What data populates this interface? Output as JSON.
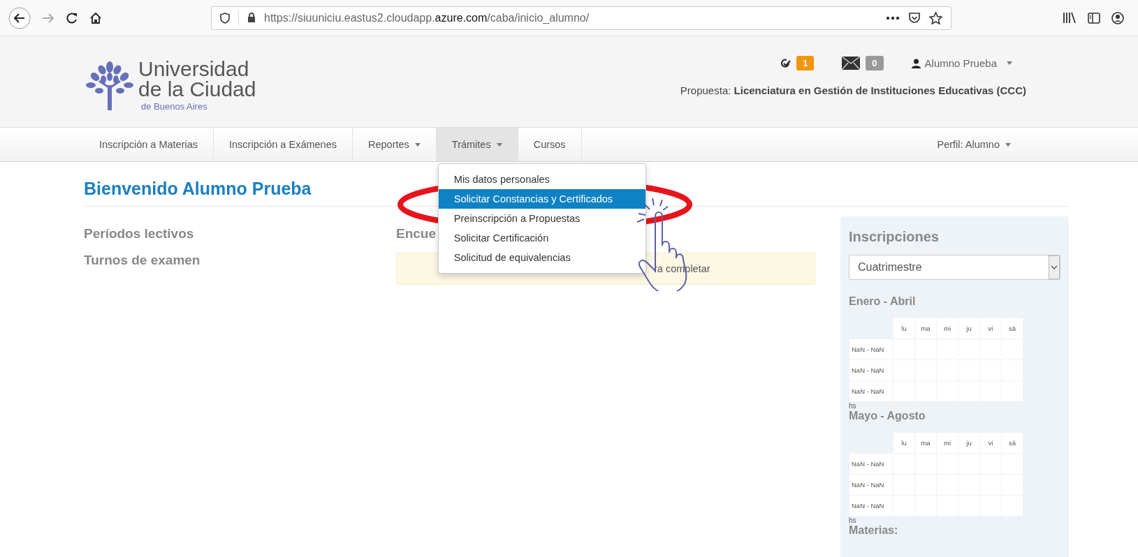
{
  "browser": {
    "url": {
      "prefix": "https://siuuniciu.eastus2.cloudapp.",
      "domain": "azure.com",
      "path": "/caba/inicio_alumno/"
    }
  },
  "header": {
    "logo": {
      "line1": "Universidad",
      "line2": "de la Ciudad",
      "line3": "de Buenos Aires"
    },
    "badges": [
      {
        "kind": "tasks",
        "count": "1",
        "color": "#f0960e"
      },
      {
        "kind": "mail",
        "count": "0",
        "color": "#999999"
      }
    ],
    "user": "Alumno Prueba",
    "propuesta_label": "Propuesta:",
    "propuesta_value": "Licenciatura en Gestión de Instituciones Educativas (CCC)"
  },
  "nav": {
    "items": [
      {
        "label": "Inscripción a Materias",
        "dropdown": false,
        "selected": false
      },
      {
        "label": "Inscripción a Exámenes",
        "dropdown": false,
        "selected": false
      },
      {
        "label": "Reportes",
        "dropdown": true,
        "selected": false
      },
      {
        "label": "Trámites",
        "dropdown": true,
        "selected": true
      },
      {
        "label": "Cursos",
        "dropdown": false,
        "selected": false
      }
    ],
    "profile": "Perfil: Alumno"
  },
  "dropdown": {
    "items": [
      {
        "label": "Mis datos personales",
        "selected": false
      },
      {
        "label": "Solicitar Constancias y Certificados",
        "selected": true
      },
      {
        "label": "Preinscripción a Propuestas",
        "selected": false
      },
      {
        "label": "Solicitar Certificación",
        "selected": false
      },
      {
        "label": "Solicitud de equivalencias",
        "selected": false
      }
    ]
  },
  "welcome": "Bienvenido Alumno Prueba",
  "left_links": [
    "Períodos lectivos",
    "Turnos de examen"
  ],
  "middle": {
    "heading": "Encue",
    "alert": "ra completar"
  },
  "panel": {
    "title": "Inscripciones",
    "select_value": "Cuatrimestre",
    "sections": [
      {
        "title": "Enero - Abril",
        "days": [
          "lu",
          "ma",
          "mi",
          "ju",
          "vi",
          "sá"
        ],
        "rows": [
          "NaN - NaN",
          "NaN - NaN",
          "NaN - NaN"
        ],
        "unit": "hs"
      },
      {
        "title": "Mayo - Agosto",
        "days": [
          "lu",
          "ma",
          "mi",
          "ju",
          "vi",
          "sá"
        ],
        "rows": [
          "NaN - NaN",
          "NaN - NaN",
          "NaN - NaN"
        ],
        "unit": "hs"
      }
    ],
    "footer": "Materias:"
  }
}
